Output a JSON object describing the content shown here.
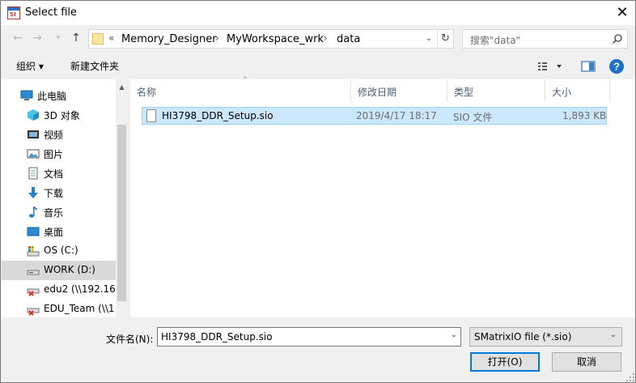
{
  "window": {
    "title": "Select file",
    "close_glyph": "✕"
  },
  "address": {
    "overflow": "«",
    "crumbs": [
      "Memory_Designer",
      "MyWorkspace_wrk",
      "data"
    ],
    "separator": "›"
  },
  "search": {
    "placeholder": "搜索\"data\""
  },
  "toolbar": {
    "organize_label": "组织 ▾",
    "new_folder_label": "新建文件夹"
  },
  "nav": {
    "items": [
      {
        "label": "此电脑",
        "icon": "computer-icon"
      },
      {
        "label": "3D 对象",
        "icon": "3d-objects-icon"
      },
      {
        "label": "视频",
        "icon": "video-icon"
      },
      {
        "label": "图片",
        "icon": "pictures-icon"
      },
      {
        "label": "文档",
        "icon": "documents-icon"
      },
      {
        "label": "下载",
        "icon": "download-icon"
      },
      {
        "label": "音乐",
        "icon": "music-icon"
      },
      {
        "label": "桌面",
        "icon": "desktop-icon"
      },
      {
        "label": "OS (C:)",
        "icon": "drive-icon"
      },
      {
        "label": "WORK (D:)",
        "icon": "drive-icon",
        "selected": true
      },
      {
        "label": "edu2 (\\\\192.16",
        "icon": "network-drive-disconnected-icon"
      },
      {
        "label": "EDU_Team (\\\\1",
        "icon": "network-drive-disconnected-icon"
      }
    ]
  },
  "columns": {
    "name": "名称",
    "modified": "修改日期",
    "type": "类型",
    "size": "大小"
  },
  "files": [
    {
      "name": "HI3798_DDR_Setup.sio",
      "modified": "2019/4/17 18:17",
      "type": "SIO 文件",
      "size": "1,893 KB"
    }
  ],
  "bottom": {
    "filename_label": "文件名(N):",
    "filename_value": "HI3798_DDR_Setup.sio",
    "filetype_value": "SMatrixIO file (*.sio)",
    "open_label": "打开(O)",
    "cancel_label": "取消"
  },
  "colors": {
    "selection_bg": "#cce8ff",
    "selection_border": "#99d1ff",
    "accent": "#0078d7",
    "header_text": "#4c607a"
  }
}
